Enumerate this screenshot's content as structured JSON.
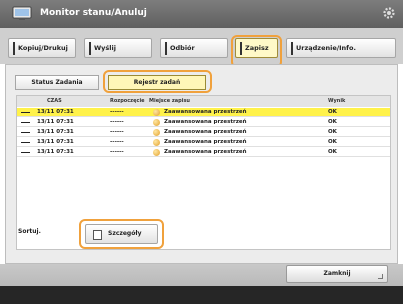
{
  "window": {
    "title": "Monitor stanu/Anuluj"
  },
  "tabs": [
    {
      "label": "Kopiuj/Drukuj"
    },
    {
      "label": "Wyślij"
    },
    {
      "label": "Odbiór"
    },
    {
      "label": "Zapisz"
    },
    {
      "label": "Urządzenie/Info."
    }
  ],
  "active_tab_index": 3,
  "subtabs": [
    {
      "label": "Status Zadania"
    },
    {
      "label": "Rejestr zadań"
    }
  ],
  "table": {
    "headers": [
      "CZAS",
      "Rozpoczęcie",
      "Miejsce zapisu",
      "Wynik"
    ],
    "rows": [
      {
        "time": "13/11 07:31",
        "start": "------",
        "location": "Zaawansowana przestrzeń",
        "result": "OK"
      },
      {
        "time": "13/11 07:31",
        "start": "------",
        "location": "Zaawansowana przestrzeń",
        "result": "OK"
      },
      {
        "time": "13/11 07:31",
        "start": "------",
        "location": "Zaawansowana przestrzeń",
        "result": "OK"
      },
      {
        "time": "13/11 07:31",
        "start": "------",
        "location": "Zaawansowana przestrzeń",
        "result": "OK"
      },
      {
        "time": "13/11 07:31",
        "start": "------",
        "location": "Zaawansowana przestrzeń",
        "result": "OK"
      }
    ]
  },
  "sort": {
    "label": "Sortuj."
  },
  "details_button": {
    "label": "Szczegóły"
  },
  "close_button": {
    "label": "Zamknij"
  },
  "colors": {
    "highlight": "#f0a13c",
    "selected_row": "#fff24a"
  }
}
